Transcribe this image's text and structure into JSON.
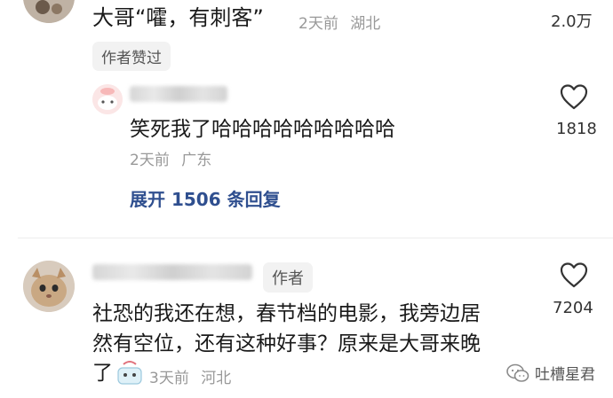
{
  "comment_top": {
    "text": "大哥“嚯，有刺客”",
    "time": "2天前",
    "location": "湖北",
    "likes": "2.0万",
    "author_liked_badge": "作者赞过"
  },
  "reply": {
    "text": "笑死我了哈哈哈哈哈哈哈哈哈",
    "time": "2天前",
    "location": "广东",
    "likes": "1818",
    "expand_label": "展开 1506 条回复"
  },
  "comment_author": {
    "author_badge": "作者",
    "text_line1": "社恐的我还在想，春节档的电影，我旁边居",
    "text_line2": "然有空位，还有这种好事？原来是大哥来晚",
    "text_line3": "了",
    "time": "3天前",
    "location": "河北",
    "likes": "7204"
  },
  "watermark": {
    "text": "吐槽星君"
  },
  "icons": [
    "heart-icon",
    "wechat-icon",
    "emoji-sticker-icon"
  ],
  "colors": {
    "expand_link": "#2f4f8f",
    "meta_gray": "#999999",
    "chip_bg": "#f2f2f2"
  }
}
